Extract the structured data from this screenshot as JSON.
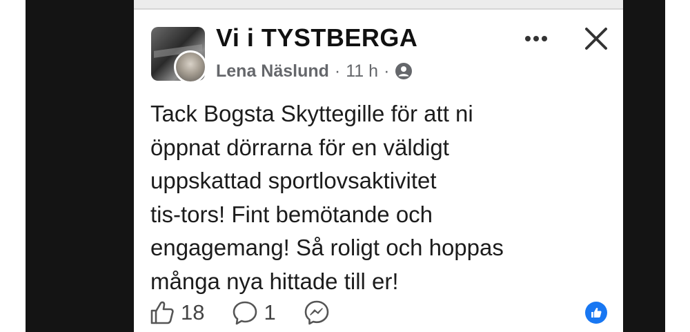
{
  "post": {
    "group_name": "Vi i TYSTBERGA",
    "author": "Lena Näslund",
    "separator_1": "·",
    "time": "11 h",
    "separator_2": "·",
    "text": "Tack Bogsta Skyttegille för att ni\nöppnat dörrarna för en väldigt\nuppskattad sportlovsaktivitet\ntis-tors! Fint bemötande och\nengagemang! Så roligt och hoppas\nmånga nya hittade till er!",
    "like_count": "18",
    "comment_count": "1"
  },
  "icons": {
    "privacy": "members-privacy-icon",
    "more": "more-options-icon",
    "close": "close-icon",
    "like": "thumbs-up-icon",
    "comment": "comment-bubble-icon",
    "share": "messenger-icon",
    "reaction": "like-reaction-icon"
  },
  "colors": {
    "accent": "#1877f2",
    "meta_text": "#65676b",
    "body_text": "#1c1c1c"
  }
}
